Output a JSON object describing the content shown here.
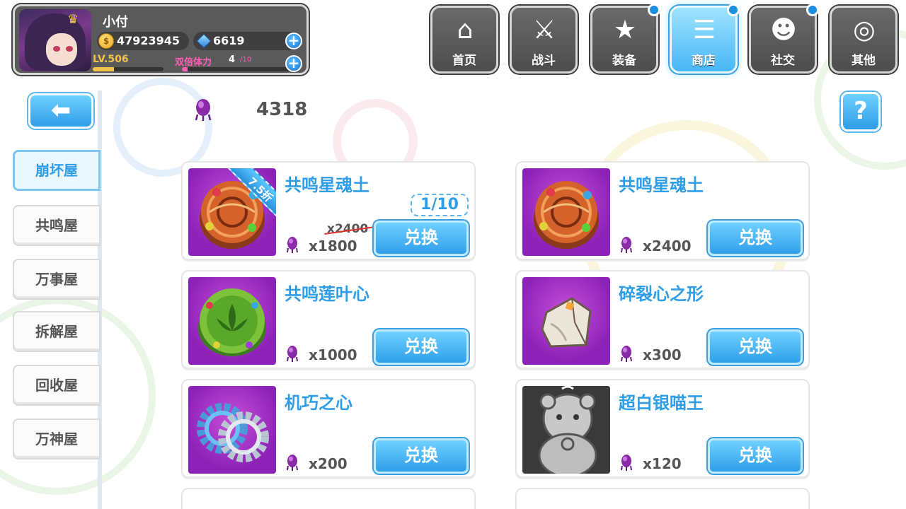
{
  "player": {
    "name": "小付",
    "gold": "47923945",
    "gems": "6619",
    "level": "LV.506",
    "stamina_label": "双倍体力",
    "stamina_value": "4",
    "stamina_max": "/10",
    "xp_fraction": 0.3,
    "stamina_fraction": 0.05
  },
  "nav": {
    "items": [
      {
        "label": "首页",
        "icon": "home-icon",
        "glyph": "⌂",
        "active": false,
        "dot": false
      },
      {
        "label": "战斗",
        "icon": "battle-icon",
        "glyph": "⚔",
        "active": false,
        "dot": false
      },
      {
        "label": "装备",
        "icon": "equipment-icon",
        "glyph": "★",
        "active": false,
        "dot": true
      },
      {
        "label": "商店",
        "icon": "shop-basket-icon",
        "glyph": "☰",
        "active": true,
        "dot": true
      },
      {
        "label": "社交",
        "icon": "social-icon",
        "glyph": "☻",
        "active": false,
        "dot": true
      },
      {
        "label": "其他",
        "icon": "other-icon",
        "glyph": "◎",
        "active": false,
        "dot": false
      }
    ]
  },
  "toolbar": {
    "back_glyph": "⬅",
    "help_glyph": "?"
  },
  "currency": {
    "amount": "4318",
    "icon": "purple-crystal-icon"
  },
  "sidebar": {
    "tabs": [
      {
        "label": "崩坏屋",
        "active": true
      },
      {
        "label": "共鸣屋",
        "active": false
      },
      {
        "label": "万事屋",
        "active": false
      },
      {
        "label": "拆解屋",
        "active": false
      },
      {
        "label": "回收屋",
        "active": false
      },
      {
        "label": "万神屋",
        "active": false
      }
    ]
  },
  "items": [
    {
      "name": "共鸣星魂土",
      "price": "x1800",
      "old_price": "x2400",
      "limit": "1/10",
      "discount": "7.5折",
      "button": "兑换",
      "icon": "star-soil-icon"
    },
    {
      "name": "共鸣星魂土",
      "price": "x2400",
      "button": "兑换",
      "icon": "star-soil-icon"
    },
    {
      "name": "共鸣莲叶心",
      "price": "x1000",
      "button": "兑换",
      "icon": "lotus-heart-icon"
    },
    {
      "name": "碎裂心之形",
      "price": "x300",
      "button": "兑换",
      "icon": "broken-heart-shape-icon"
    },
    {
      "name": "机巧之心",
      "price": "x200",
      "button": "兑换",
      "icon": "gear-heart-icon"
    },
    {
      "name": "超白银喵王",
      "price": "x120",
      "button": "兑换",
      "icon": "silver-cat-king-icon"
    }
  ],
  "colors": {
    "accent": "#2e9ee8",
    "item_bg": "#8d22b8",
    "stamina": "#ff5fb5",
    "level": "#f0c34a"
  }
}
